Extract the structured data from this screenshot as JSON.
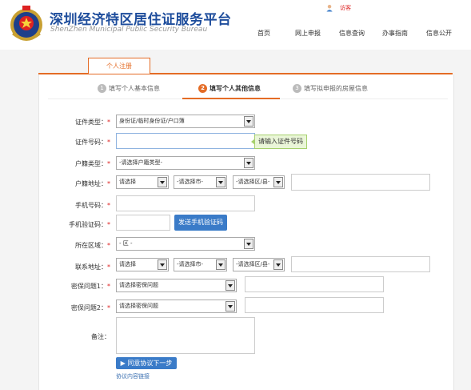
{
  "header": {
    "title": "深圳经济特区居住证服务平台",
    "subtitle": "ShenZhen Municipal Public Security Bureau",
    "user_label": "访客",
    "nav": [
      "首页",
      "网上申报",
      "信息查询",
      "办事指南",
      "信息公开"
    ]
  },
  "tab": {
    "label": "个人注册"
  },
  "steps": [
    {
      "num": "1",
      "label": "填写个人基本信息"
    },
    {
      "num": "2",
      "label": "填写个人其他信息"
    },
    {
      "num": "3",
      "label": "填写拟申报的房屋信息"
    }
  ],
  "form": {
    "id_type": {
      "label": "证件类型：",
      "value": "身份证/临时身份证/户口簿"
    },
    "id_number": {
      "label": "证件号码：",
      "tip": "请输入证件号码"
    },
    "household_type": {
      "label": "户籍类型：",
      "value": "-请选择户籍类型-"
    },
    "household_address": {
      "label": "户籍地址：",
      "province": "请选择",
      "city": "-请选择市-",
      "district": "-请选择区/县-"
    },
    "mobile": {
      "label": "手机号码："
    },
    "sms_code": {
      "label": "手机验证码：",
      "button": "发送手机验证码"
    },
    "region": {
      "label": "所在区域：",
      "value": "- 区 -"
    },
    "contact_address": {
      "label": "联系地址：",
      "province": "请选择",
      "city": "-请选择市-",
      "district": "-请选择区/县-"
    },
    "security_q1": {
      "label": "密保问题1：",
      "value": "请选择密保问题"
    },
    "security_q2": {
      "label": "密保问题2：",
      "value": "请选择密保问题"
    },
    "remark": {
      "label": "备注："
    },
    "agree_button": "同意协议下一步",
    "agreement_link": "协议内容链接"
  },
  "colors": {
    "brand_blue": "#1e4d9c",
    "accent_orange": "#e46c26",
    "button_blue": "#3a7bc8"
  }
}
